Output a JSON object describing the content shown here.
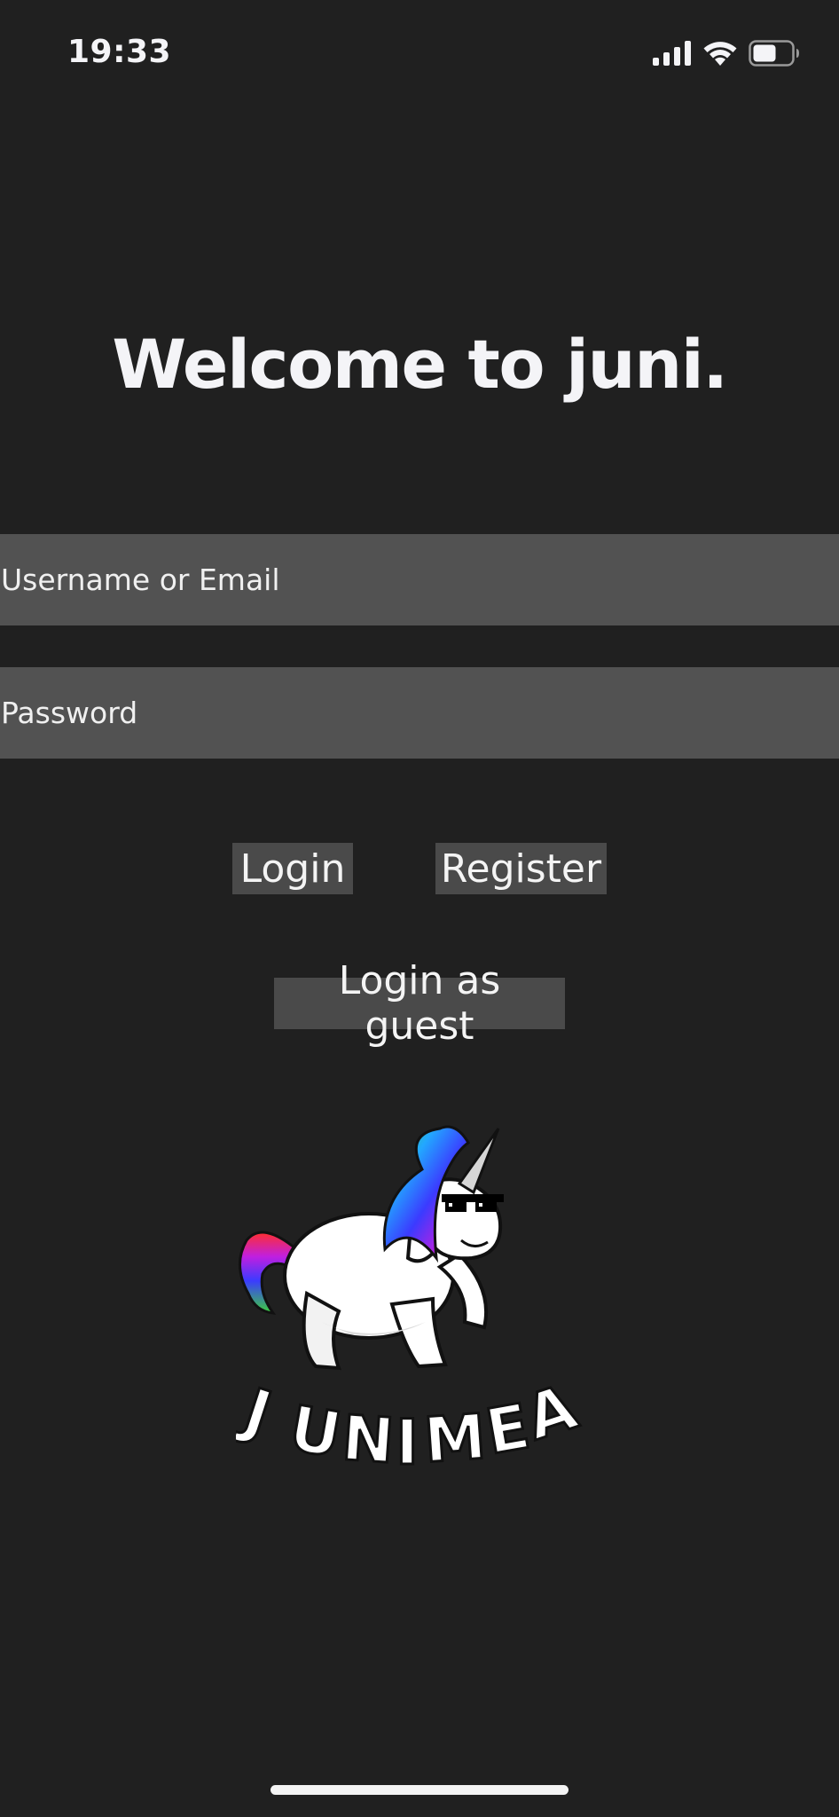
{
  "status_bar": {
    "time": "19:33",
    "icons": [
      "cellular-signal-icon",
      "wifi-icon",
      "battery-icon"
    ],
    "battery_level": 0.6
  },
  "welcome": {
    "title": "Welcome to juni."
  },
  "form": {
    "username_placeholder": "Username or Email",
    "password_placeholder": "Password"
  },
  "actions": {
    "login_label": "Login",
    "register_label": "Register",
    "guest_label": "Login as guest"
  },
  "logo": {
    "wordmark": "JUNIMEA",
    "description_icon": "unicorn-logo"
  },
  "colors": {
    "background": "#202020",
    "field": "#525252",
    "button": "#4a4a4a",
    "text": "#f4f4f7"
  }
}
